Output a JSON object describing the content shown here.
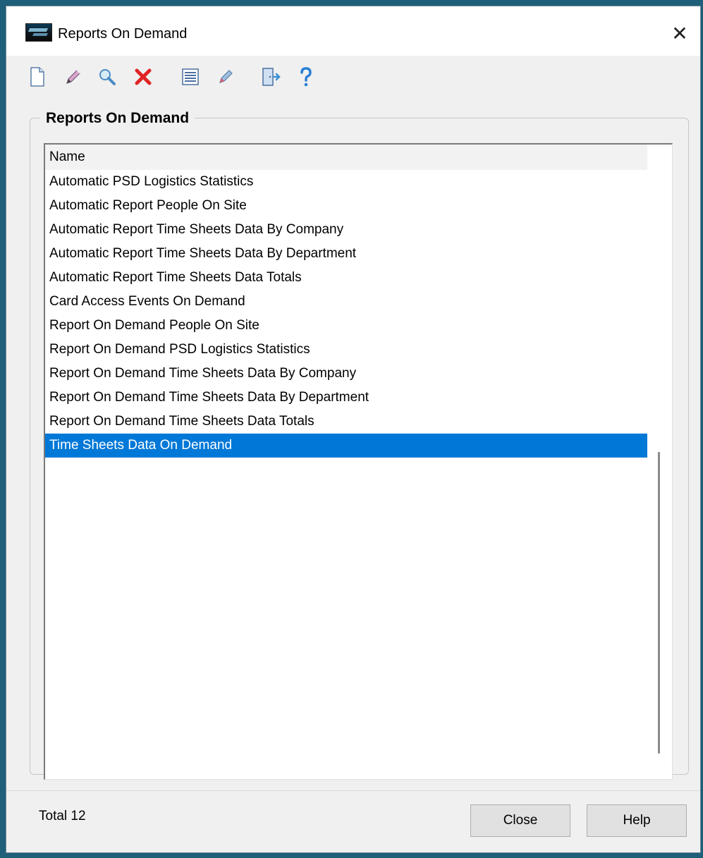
{
  "window": {
    "title": "Reports On Demand",
    "close_glyph": "✕"
  },
  "toolbar": {
    "buttons": [
      {
        "name": "new",
        "icon": "new-document-icon"
      },
      {
        "name": "edit",
        "icon": "pencil-icon"
      },
      {
        "name": "view",
        "icon": "magnifier-icon"
      },
      {
        "name": "delete",
        "icon": "red-x-icon"
      },
      {
        "name": "list",
        "icon": "list-icon"
      },
      {
        "name": "clear",
        "icon": "eraser-icon"
      },
      {
        "name": "exit",
        "icon": "exit-door-icon"
      },
      {
        "name": "help",
        "icon": "question-icon"
      }
    ]
  },
  "group": {
    "title": "Reports On Demand"
  },
  "list": {
    "column_header": "Name",
    "selected_index": 11,
    "items": [
      "Automatic PSD Logistics Statistics",
      "Automatic Report People On Site",
      "Automatic Report Time Sheets Data By Company",
      "Automatic Report Time Sheets Data By Department",
      "Automatic Report Time Sheets Data Totals",
      "Card Access Events On Demand",
      "Report On Demand People On Site",
      "Report On Demand PSD Logistics Statistics",
      "Report On Demand Time Sheets Data By Company",
      "Report On Demand Time Sheets Data By Department",
      "Report On Demand Time Sheets Data Totals",
      "Time Sheets Data On Demand"
    ]
  },
  "status": {
    "total_text": "Total 12"
  },
  "buttons": {
    "close": "Close",
    "help": "Help"
  },
  "colors": {
    "selection": "#0078d7",
    "delete_icon": "#e02424",
    "help_icon": "#2a7fd6"
  }
}
